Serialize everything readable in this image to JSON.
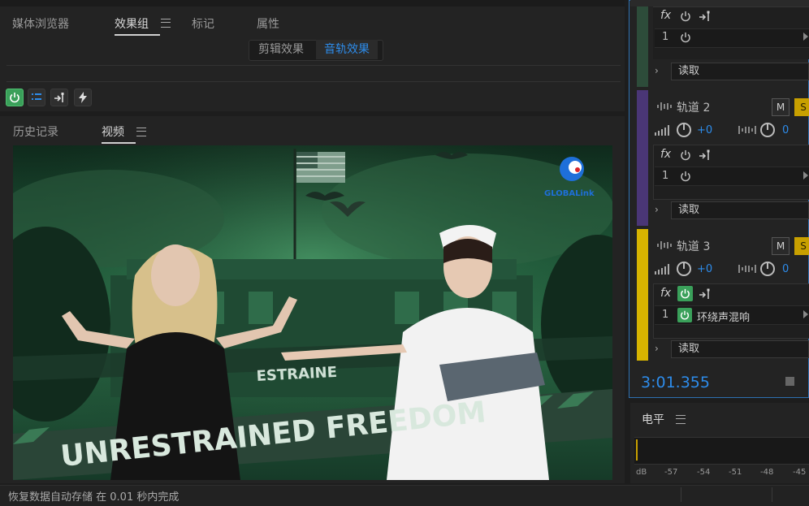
{
  "left_panel": {
    "tabs": [
      "媒体浏览器",
      "效果组",
      "标记",
      "属性"
    ],
    "segment": {
      "clip_effects": "剪辑效果",
      "track_effects": "音轨效果"
    }
  },
  "video_panel": {
    "tabs": [
      "历史记录",
      "视频"
    ],
    "video": {
      "logo_text": "GLOBALink",
      "banner_text": "UNRESTRAINED FREEDOM",
      "banner_small": "ESTRAINE"
    }
  },
  "mixer": {
    "tracks": [
      {
        "name": "",
        "fx": "fx",
        "slot_num": "1",
        "slot_effect": "",
        "read": "读取",
        "color": "#2d4c3a"
      },
      {
        "name": "轨道 2",
        "m": "M",
        "s": "S",
        "vol": "+0",
        "pan": "0",
        "fx": "fx",
        "slot_num": "1",
        "slot_effect": "",
        "read": "读取",
        "color": "#4a3676"
      },
      {
        "name": "轨道 3",
        "m": "M",
        "s": "S",
        "vol": "+0",
        "pan": "0",
        "fx": "fx",
        "slot_num": "1",
        "slot_effect": "环绕声混响",
        "read": "读取",
        "color": "#d8b400"
      }
    ],
    "time": "3:01.355"
  },
  "levels": {
    "title": "电平",
    "scale": [
      "dB",
      "-57",
      "-54",
      "-51",
      "-48",
      "-45"
    ]
  },
  "status": {
    "text": "恢复数据自动存储 在 0.01 秒内完成"
  },
  "colors": {
    "accent": "#2d8ceb",
    "power_green": "#3aa05a",
    "solo_yellow": "#c8a000"
  }
}
